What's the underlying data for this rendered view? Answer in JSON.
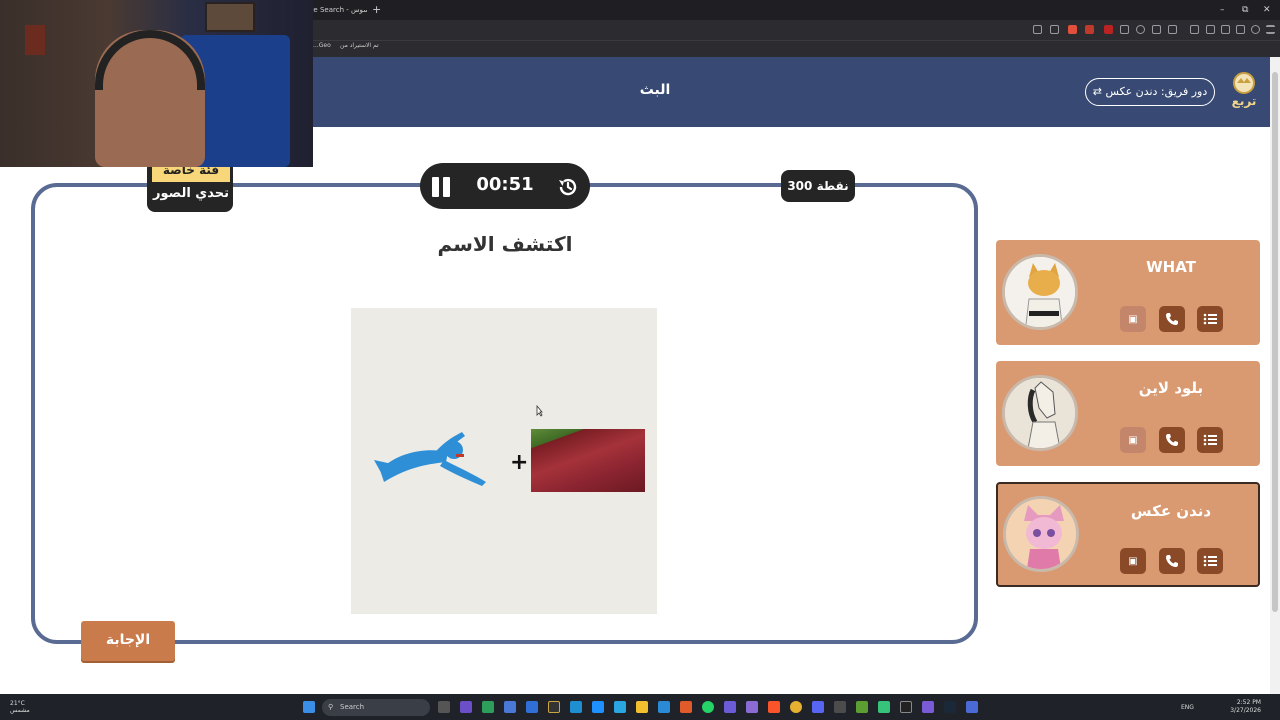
{
  "browser": {
    "tab_title": "ave Search - أوسوس",
    "new_tab_glyph": "+",
    "bookmarks": [
      "تم الاستيراد من",
      "...Geo"
    ],
    "window_controls": [
      "–",
      "⧉",
      "✕"
    ]
  },
  "header": {
    "title": "البث",
    "team_turn_label": "دور فريق: دندن عكس",
    "logo_text": "تربع"
  },
  "game": {
    "timer": "00:51",
    "points": "300 نقطة",
    "category_label": "فئة خاصة",
    "category_name": "تحدي الصور",
    "question": "اكتشف الاسم",
    "puzzle_plus": "+",
    "answer_button": "الإجابة"
  },
  "teams": [
    {
      "name": "WHAT",
      "avatar": "cat-karate-avatar",
      "active": false
    },
    {
      "name": "بلود لاين",
      "avatar": "horse-avatar",
      "active": false
    },
    {
      "name": "دندن عكس",
      "avatar": "pink-cat-avatar",
      "active": true
    }
  ],
  "team_buttons": [
    "money-icon",
    "phone-icon",
    "list-icon"
  ],
  "taskbar": {
    "weather_temp": "21°C",
    "weather_desc": "مشمس",
    "search_placeholder": "Search",
    "lang": "ENG",
    "time": "2:52 PM",
    "date": "3/27/2026"
  },
  "colors": {
    "header_bg": "#384a73",
    "panel_border": "#5a6b93",
    "card_bg": "#d99a71",
    "card_button": "#8a4a28",
    "answer_button": "#c97b4c",
    "timer_bg": "#252525",
    "category_highlight": "#f7d779"
  }
}
